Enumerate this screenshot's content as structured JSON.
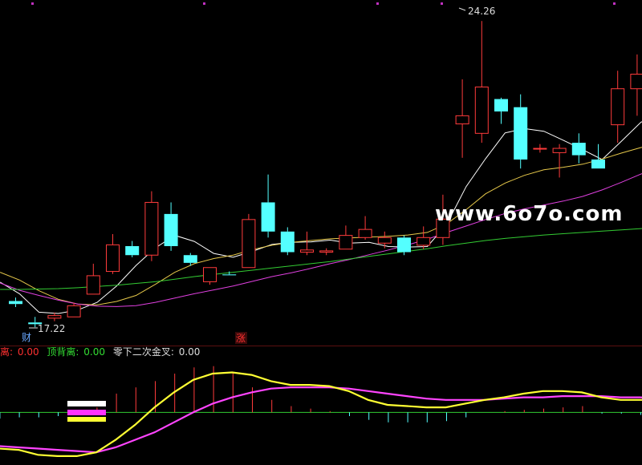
{
  "watermark": "www.6o7o.com",
  "markers": {
    "high_label": "24.26",
    "low_label": "17.22",
    "left_marker": "财",
    "center_marker": "涨"
  },
  "indicator_bar": {
    "div_bottom_prefix": "离:",
    "div_bottom_value": "0.00",
    "div_top_label": "顶背离:",
    "div_top_value": "0.00",
    "cross_label": "零下二次金叉:",
    "cross_value": "0.00"
  },
  "colors": {
    "up": "#ff3b3b",
    "down": "#54ffff",
    "ma5": "#ffffff",
    "ma10": "#e6c84a",
    "ma20": "#e040e0",
    "ma60": "#33cc33",
    "dif": "#ffff33",
    "dea": "#ff44ff",
    "zero": "#33cc33",
    "label_red": "#ff3030",
    "label_green": "#33dd33",
    "label_white": "#dddddd"
  },
  "chart_data": [
    {
      "type": "candlestick",
      "series": [
        {
          "name": "",
          "candles": [
            [
              17.73,
              17.66,
              17.59,
              17.81
            ],
            [
              17.23,
              17.19,
              17.12,
              17.36
            ],
            [
              17.33,
              17.39,
              17.26,
              17.46
            ],
            [
              17.36,
              17.62,
              17.36,
              17.69
            ],
            [
              17.89,
              18.32,
              17.89,
              18.6
            ],
            [
              18.42,
              19.04,
              18.36,
              19.29
            ],
            [
              19.01,
              18.8,
              18.75,
              19.13
            ],
            [
              18.8,
              20.03,
              18.66,
              20.29
            ],
            [
              19.76,
              19.01,
              18.9,
              20.03
            ],
            [
              18.8,
              18.62,
              18.55,
              18.85
            ],
            [
              18.18,
              18.51,
              18.11,
              18.51
            ],
            [
              18.35,
              18.33,
              18.33,
              18.42
            ],
            [
              18.51,
              19.63,
              18.51,
              19.76
            ],
            [
              20.03,
              19.35,
              19.21,
              20.68
            ],
            [
              19.35,
              18.87,
              18.8,
              19.45
            ],
            [
              18.87,
              18.92,
              18.8,
              19.35
            ],
            [
              18.87,
              18.9,
              18.8,
              18.96
            ],
            [
              18.94,
              19.26,
              18.94,
              19.49
            ],
            [
              19.21,
              19.4,
              19.16,
              19.71
            ],
            [
              19.08,
              19.21,
              18.96,
              19.35
            ],
            [
              19.21,
              18.87,
              18.8,
              19.26
            ],
            [
              19.03,
              19.21,
              18.94,
              19.47
            ],
            [
              19.21,
              19.64,
              19.04,
              20.21
            ],
            [
              21.86,
              22.05,
              21.07,
              22.9
            ],
            [
              21.64,
              22.72,
              21.42,
              24.26
            ],
            [
              22.44,
              22.15,
              21.86,
              22.47
            ],
            [
              22.25,
              21.03,
              20.82,
              22.55
            ],
            [
              21.29,
              21.29,
              21.19,
              21.39
            ],
            [
              21.19,
              21.29,
              20.61,
              21.39
            ],
            [
              21.42,
              21.13,
              20.94,
              21.64
            ],
            [
              21.03,
              20.82,
              20.82,
              21.39
            ],
            [
              21.84,
              22.68,
              21.42,
              23.1
            ],
            [
              22.68,
              23.02,
              22.05,
              23.48
            ],
            [
              22.51,
              22.55,
              22.41,
              23.58
            ]
          ]
        },
        {
          "name": "",
          "values": [
            18.17,
            17.9,
            17.47,
            17.44,
            17.52,
            17.7,
            18.08,
            18.56,
            18.97,
            19.26,
            19.12,
            18.84,
            18.75,
            18.89,
            19.05,
            19.1,
            19.11,
            19.15,
            19.08,
            19.1,
            19.0,
            18.99,
            19.0,
            19.52,
            20.4,
            21.05,
            21.65,
            21.75,
            21.69,
            21.48,
            21.26,
            21.03,
            21.46,
            21.9,
            22.12
          ]
        },
        {
          "name": "",
          "values": [
            18.4,
            18.22,
            17.97,
            17.77,
            17.66,
            17.64,
            17.72,
            17.86,
            18.12,
            18.4,
            18.6,
            18.72,
            18.8,
            18.93,
            19.03,
            19.1,
            19.14,
            19.18,
            19.2,
            19.22,
            19.24,
            19.27,
            19.33,
            19.53,
            19.86,
            20.23,
            20.48,
            20.66,
            20.79,
            20.85,
            20.92,
            21.04,
            21.18,
            21.31,
            21.4
          ]
        },
        {
          "name": "",
          "values": [
            18.15,
            17.98,
            17.86,
            17.75,
            17.66,
            17.61,
            17.6,
            17.62,
            17.7,
            17.8,
            17.9,
            17.99,
            18.08,
            18.19,
            18.3,
            18.39,
            18.49,
            18.6,
            18.7,
            18.81,
            18.92,
            19.04,
            19.17,
            19.33,
            19.48,
            19.63,
            19.77,
            19.88,
            19.97,
            20.06,
            20.17,
            20.32,
            20.5,
            20.69,
            20.85
          ]
        },
        {
          "name": "",
          "values": [
            18.0,
            18.0,
            18.01,
            18.02,
            18.04,
            18.07,
            18.1,
            18.14,
            18.18,
            18.24,
            18.3,
            18.35,
            18.4,
            18.45,
            18.5,
            18.55,
            18.6,
            18.65,
            18.71,
            18.77,
            18.83,
            18.89,
            18.95,
            19.02,
            19.08,
            19.14,
            19.19,
            19.23,
            19.27,
            19.3,
            19.33,
            19.36,
            19.39,
            19.42,
            19.45
          ]
        }
      ],
      "ylim": [
        16.86,
        24.6
      ]
    },
    {
      "type": "line",
      "series": [
        {
          "name": "",
          "values": [
            -0.29,
            -0.3,
            -0.34,
            -0.35,
            -0.35,
            -0.32,
            -0.22,
            -0.1,
            0.04,
            0.16,
            0.26,
            0.31,
            0.32,
            0.3,
            0.25,
            0.22,
            0.22,
            0.21,
            0.17,
            0.1,
            0.06,
            0.05,
            0.04,
            0.04,
            0.07,
            0.1,
            0.12,
            0.15,
            0.17,
            0.17,
            0.16,
            0.12,
            0.1,
            0.1,
            0.1,
            0.1
          ]
        },
        {
          "name": "",
          "values": [
            -0.27,
            -0.28,
            -0.29,
            -0.3,
            -0.31,
            -0.32,
            -0.28,
            -0.22,
            -0.16,
            -0.08,
            0.0,
            0.07,
            0.12,
            0.16,
            0.19,
            0.2,
            0.2,
            0.2,
            0.19,
            0.17,
            0.15,
            0.13,
            0.11,
            0.1,
            0.1,
            0.1,
            0.11,
            0.12,
            0.12,
            0.13,
            0.13,
            0.13,
            0.12,
            0.12,
            0.11,
            0.11
          ]
        },
        {
          "name": "",
          "type": "bar",
          "values": [
            -0.05,
            -0.04,
            -0.04,
            -0.03,
            0.0,
            0.04,
            0.15,
            0.2,
            0.25,
            0.31,
            0.36,
            0.37,
            0.32,
            0.2,
            0.1,
            0.05,
            0.03,
            0.01,
            -0.03,
            -0.06,
            -0.08,
            -0.08,
            -0.08,
            -0.07,
            -0.04,
            0.0,
            0.01,
            0.02,
            0.03,
            0.04,
            0.05,
            -0.01,
            -0.01,
            -0.02,
            -0.02,
            0.0
          ]
        }
      ],
      "ylim": [
        -0.37,
        0.4
      ]
    }
  ]
}
